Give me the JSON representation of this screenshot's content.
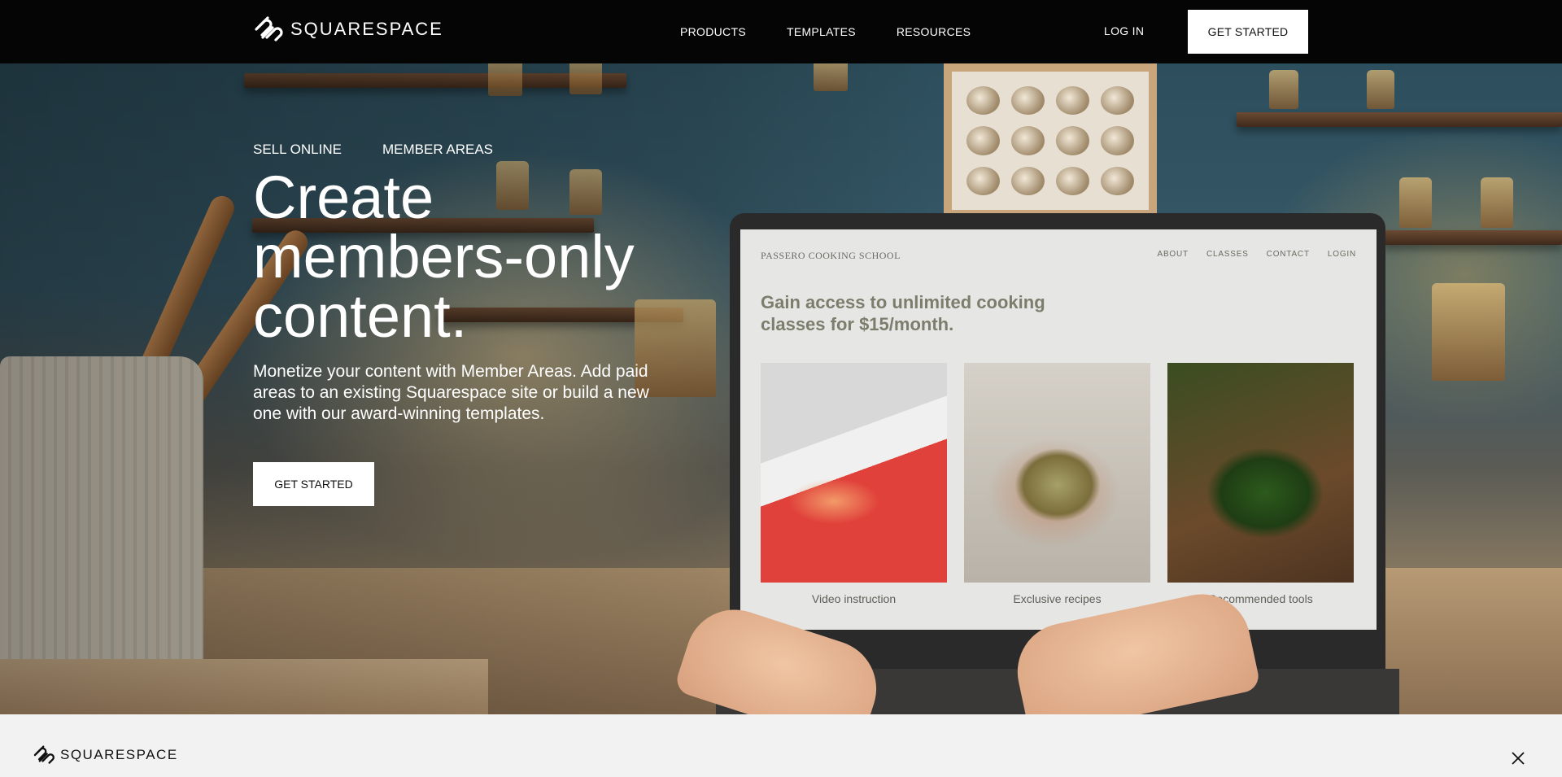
{
  "nav": {
    "brand": "SQUARESPACE",
    "links": [
      "PRODUCTS",
      "TEMPLATES",
      "RESOURCES"
    ],
    "login": "LOG IN",
    "cta": "GET STARTED"
  },
  "hero": {
    "tabs": [
      "SELL ONLINE",
      "MEMBER AREAS"
    ],
    "headline": "Create members-only content.",
    "subcopy": "Monetize your content with Member Areas. Add paid areas to an existing Squarespace site or build a new one with our award-winning templates.",
    "cta": "GET STARTED"
  },
  "laptop_site": {
    "name": "PASSERO COOKING SCHOOL",
    "nav": [
      "ABOUT",
      "CLASSES",
      "CONTACT",
      "LOGIN"
    ],
    "headline": "Gain access to unlimited cooking classes for $15/month.",
    "cards": [
      {
        "caption": "Video instruction"
      },
      {
        "caption": "Exclusive recipes"
      },
      {
        "caption": "Recommended tools"
      }
    ]
  },
  "bottom_bar": {
    "brand": "SQUARESPACE"
  }
}
